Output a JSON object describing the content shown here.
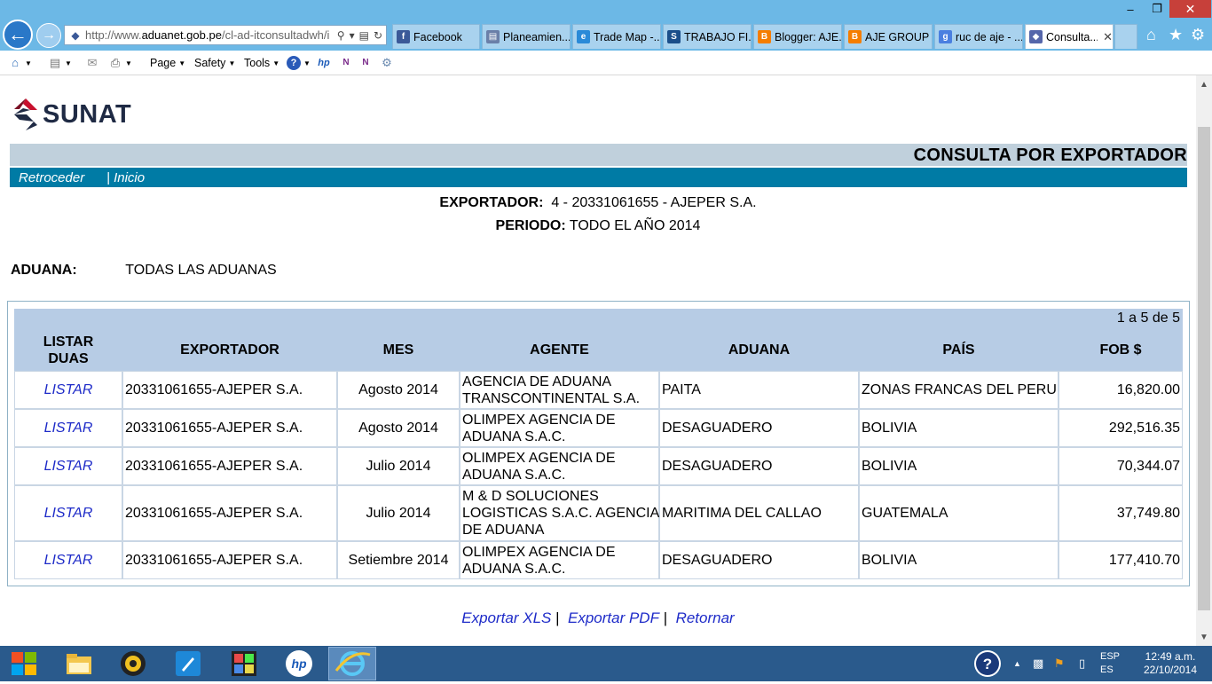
{
  "browser": {
    "url_prefix": "http://www.",
    "url_domain": "aduanet.gob.pe",
    "url_suffix": "/cl-ad-itconsultadwh/i",
    "tabs": [
      {
        "label": "Facebook",
        "icon": "facebook-icon",
        "color": "#3b5998",
        "glyph": "f"
      },
      {
        "label": "Planeamien...",
        "icon": "document-icon",
        "color": "#6a7fa8",
        "glyph": "▤"
      },
      {
        "label": "Trade Map -...",
        "icon": "ie-icon",
        "color": "#2a8ad8",
        "glyph": "e"
      },
      {
        "label": "TRABAJO FI...",
        "icon": "scribd-icon",
        "color": "#1a4e8a",
        "glyph": "S"
      },
      {
        "label": "Blogger: AJE...",
        "icon": "blogger-icon",
        "color": "#f57d00",
        "glyph": "B"
      },
      {
        "label": "AJE GROUP",
        "icon": "blogger-icon",
        "color": "#f57d00",
        "glyph": "B"
      },
      {
        "label": "ruc de aje - ...",
        "icon": "google-icon",
        "color": "#4a7fe0",
        "glyph": "g"
      },
      {
        "label": "Consulta...",
        "icon": "diamond-icon",
        "color": "#5566aa",
        "glyph": "◆"
      }
    ],
    "close_glyph": "✕",
    "menus": [
      "Page",
      "Safety",
      "Tools"
    ]
  },
  "page": {
    "logo_text": "SUNAT",
    "title": "CONSULTA POR EXPORTADOR",
    "nav_back": "Retroceder",
    "nav_home": "| Inicio",
    "exportador_label": "EXPORTADOR:",
    "exportador_value": "4 - 20331061655 - AJEPER S.A.",
    "periodo_label": "PERIODO:",
    "periodo_value": "TODO EL AÑO 2014",
    "aduana_label": "ADUANA:",
    "aduana_value": "TODAS LAS ADUANAS",
    "pager": "1 a 5 de 5"
  },
  "table": {
    "headers": {
      "listar_1": "LISTAR",
      "listar_2": "DUAS",
      "exportador": "EXPORTADOR",
      "mes": "MES",
      "agente": "AGENTE",
      "aduana": "ADUANA",
      "pais": "PAÍS",
      "fob": "FOB $"
    },
    "rows": [
      {
        "link": "LISTAR",
        "exportador": "20331061655-AJEPER S.A.",
        "mes": "Agosto 2014",
        "agente": "AGENCIA DE ADUANA TRANSCONTINENTAL S.A.",
        "aduana": "PAITA",
        "pais": "ZONAS FRANCAS DEL PERU",
        "fob": "16,820.00"
      },
      {
        "link": "LISTAR",
        "exportador": "20331061655-AJEPER S.A.",
        "mes": "Agosto 2014",
        "agente": "OLIMPEX AGENCIA DE ADUANA S.A.C.",
        "aduana": "DESAGUADERO",
        "pais": "BOLIVIA",
        "fob": "292,516.35"
      },
      {
        "link": "LISTAR",
        "exportador": "20331061655-AJEPER S.A.",
        "mes": "Julio 2014",
        "agente": "OLIMPEX AGENCIA DE ADUANA S.A.C.",
        "aduana": "DESAGUADERO",
        "pais": "BOLIVIA",
        "fob": "70,344.07"
      },
      {
        "link": "LISTAR",
        "exportador": "20331061655-AJEPER S.A.",
        "mes": "Julio 2014",
        "agente": "M & D SOLUCIONES LOGISTICAS S.A.C. AGENCIA DE ADUANA",
        "aduana": "MARITIMA DEL CALLAO",
        "pais": "GUATEMALA",
        "fob": "37,749.80"
      },
      {
        "link": "LISTAR",
        "exportador": "20331061655-AJEPER S.A.",
        "mes": "Setiembre 2014",
        "agente": "OLIMPEX AGENCIA DE ADUANA S.A.C.",
        "aduana": "DESAGUADERO",
        "pais": "BOLIVIA",
        "fob": "177,410.70"
      }
    ]
  },
  "footer": {
    "export_xls": "Exportar XLS",
    "export_pdf": "Exportar PDF",
    "back": "Retornar",
    "sep": "|"
  },
  "taskbar": {
    "lang_1": "ESP",
    "lang_2": "ES",
    "time": "12:49 a.m.",
    "date": "22/10/2014"
  }
}
